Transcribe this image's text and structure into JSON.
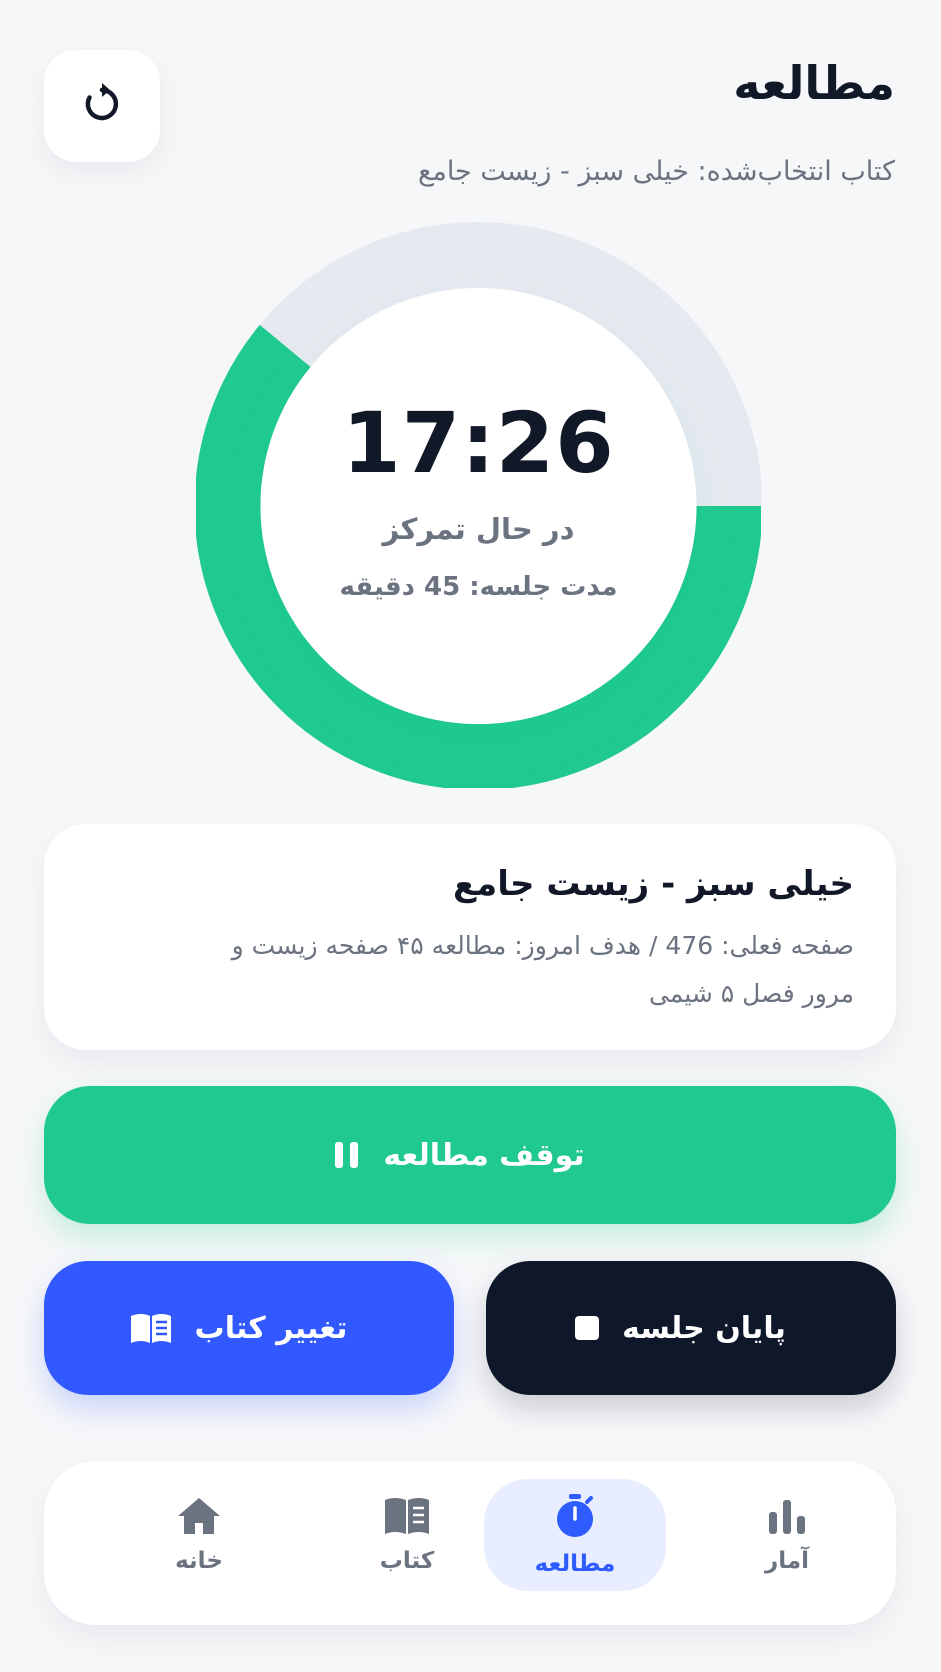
{
  "header": {
    "title": "مطالعه",
    "selected_book": "کتاب انتخاب‌شده: خیلی سبز - زیست جامع"
  },
  "timer": {
    "time": "17:26",
    "status": "در حال تمرکز",
    "session_duration": "مدت جلسه: 45 دقیقه",
    "progress_fraction": 0.61
  },
  "book_card": {
    "title": "خیلی سبز - زیست جامع",
    "description_line1": "صفحه فعلی: 476 / هدف امروز: مطالعه ۴۵ صفحه زیست و",
    "description_line2": "مرور فصل ۵ شیمی"
  },
  "actions": {
    "pause_label": "توقف مطالعه",
    "change_book_label": "تغییر کتاب",
    "end_session_label": "پایان جلسه"
  },
  "nav": {
    "items": [
      {
        "label": "خانه",
        "icon": "home-icon"
      },
      {
        "label": "کتاب",
        "icon": "book-icon"
      },
      {
        "label": "مطالعه",
        "icon": "stopwatch-icon",
        "active": true
      },
      {
        "label": "آمار",
        "icon": "bar-chart-icon"
      }
    ]
  },
  "colors": {
    "accent_green": "#20c98f",
    "accent_blue": "#3159ff",
    "dark": "#0f172a",
    "ring_track": "#e6e9f0",
    "nav_active_bg": "#e8eeff"
  }
}
